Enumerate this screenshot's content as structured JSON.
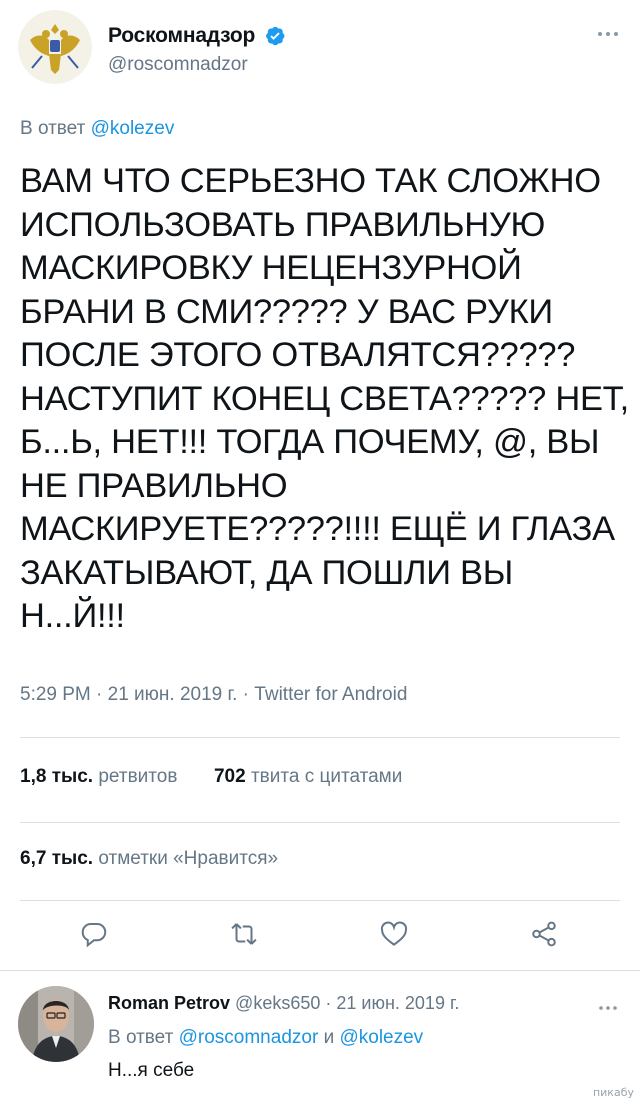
{
  "author": {
    "display_name": "Роскомнадзор",
    "handle": "@roscomnadzor",
    "verified": true
  },
  "tweet": {
    "reply_to_prefix": "В ответ",
    "reply_to_mention": "@kolezev",
    "lines": [
      "ВАМ ЧТО СЕРЬЕЗНО ТАК СЛОЖНО",
      "ИСПОЛЬЗОВАТЬ ПРАВИЛЬНУЮ",
      "МАСКИРОВКУ НЕЦЕНЗУРНОЙ",
      "БРАНИ В СМИ????? У ВАС РУКИ",
      "ПОСЛЕ ЭТОГО ОТВАЛЯТСЯ?????",
      "НАСТУПИТ КОНЕЦ СВЕТА????? НЕТ,",
      "Б...Ь, НЕТ!!! ТОГДА ПОЧЕМУ, @, ВЫ",
      "НЕ ПРАВИЛЬНО",
      "МАСКИРУЕТЕ?????!!!! ЕЩЁ И ГЛАЗА",
      "ЗАКАТЫВАЮТ, ДА ПОШЛИ ВЫ",
      "Н...Й!!!"
    ],
    "meta": "5:29 PM · 21 июн. 2019 г. · Twitter for Android"
  },
  "stats": {
    "retweets_count": "1,8 тыс.",
    "retweets_label": "ретвитов",
    "quotes_count": "702",
    "quotes_label": "твита с цитатами",
    "likes_count": "6,7 тыс.",
    "likes_label": "отметки «Нравится»"
  },
  "actions": [
    "reply-icon",
    "retweet-icon",
    "like-icon",
    "share-icon"
  ],
  "reply": {
    "display_name": "Roman Petrov",
    "handle": "@keks650",
    "date": "· 21 июн. 2019 г.",
    "reply_to_prefix": "В ответ",
    "reply_to_mention_1": "@roscomnadzor",
    "reply_to_and": "и",
    "reply_to_mention_2": "@kolezev",
    "text": "Н...я себе"
  },
  "watermark": "пикабу",
  "colors": {
    "accent": "#1b95e0",
    "secondary_text": "#657786",
    "divider": "#d9dfe3"
  }
}
